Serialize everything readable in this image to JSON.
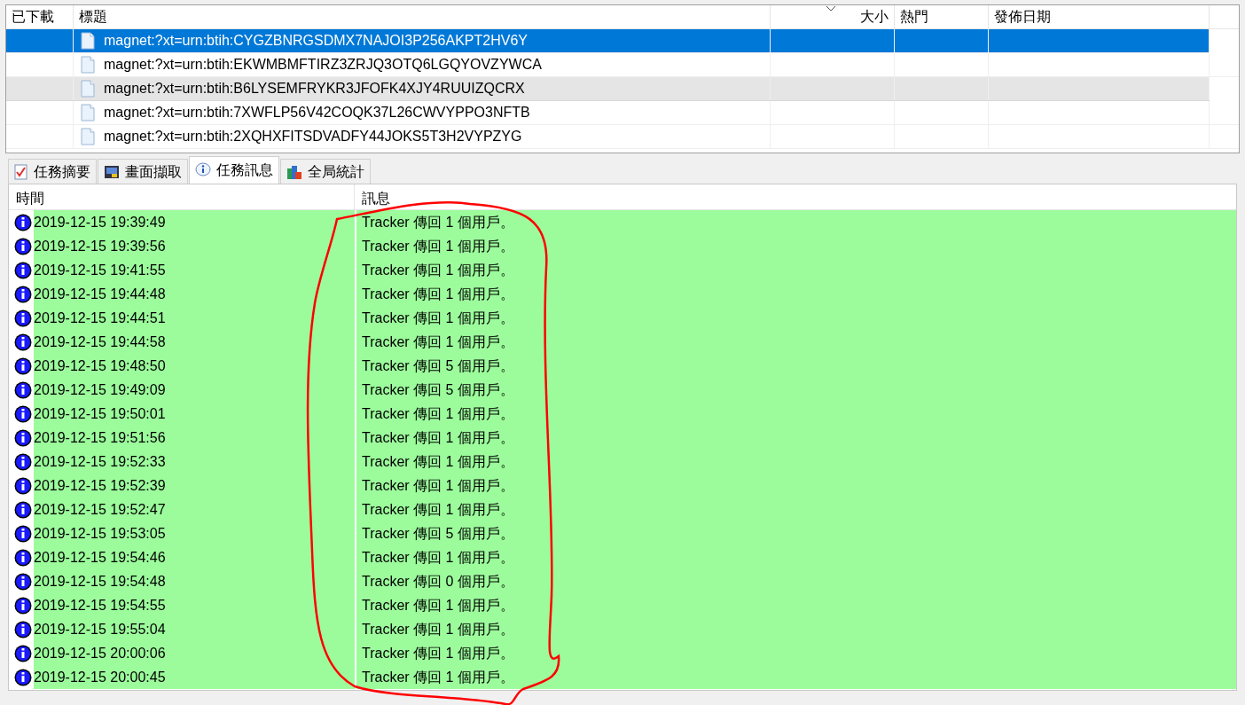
{
  "torrents": {
    "columns": [
      {
        "label": "已下載",
        "sorted": false
      },
      {
        "label": "標題",
        "sorted": false
      },
      {
        "label": "大小",
        "sorted": true
      },
      {
        "label": "熱門",
        "sorted": false
      },
      {
        "label": "發佈日期",
        "sorted": false
      }
    ],
    "rows": [
      {
        "title": "magnet:?xt=urn:btih:CYGZBNRGSDMX7NAJOI3P256AKPT2HV6Y",
        "selected": true,
        "hovered": false
      },
      {
        "title": "magnet:?xt=urn:btih:EKWMBMFTIRZ3ZRJQ3OTQ6LGQYOVZYWCA",
        "selected": false,
        "hovered": false
      },
      {
        "title": "magnet:?xt=urn:btih:B6LYSEMFRYKR3JFOFK4XJY4RUUIZQCRX",
        "selected": false,
        "hovered": true
      },
      {
        "title": "magnet:?xt=urn:btih:7XWFLP56V42COQK37L26CWVYPPO3NFTB",
        "selected": false,
        "hovered": false
      },
      {
        "title": "magnet:?xt=urn:btih:2XQHXFITSDVADFY44JOKS5T3H2VYPZYG",
        "selected": false,
        "hovered": false
      }
    ]
  },
  "tabs": [
    {
      "label": "任務摘要",
      "selected": false
    },
    {
      "label": "畫面擷取",
      "selected": false
    },
    {
      "label": "任務訊息",
      "selected": true
    },
    {
      "label": "全局統計",
      "selected": false
    }
  ],
  "log": {
    "columns": [
      "時間",
      "訊息"
    ],
    "rows": [
      {
        "kind": "info",
        "time": "2019-12-15 19:39:49",
        "message": "Tracker 傳回 1 個用戶。"
      },
      {
        "kind": "info",
        "time": "2019-12-15 19:39:56",
        "message": "Tracker 傳回 1 個用戶。"
      },
      {
        "kind": "info",
        "time": "2019-12-15 19:41:55",
        "message": "Tracker 傳回 1 個用戶。"
      },
      {
        "kind": "info",
        "time": "2019-12-15 19:44:48",
        "message": "Tracker 傳回 1 個用戶。"
      },
      {
        "kind": "info",
        "time": "2019-12-15 19:44:51",
        "message": "Tracker 傳回 1 個用戶。"
      },
      {
        "kind": "info",
        "time": "2019-12-15 19:44:58",
        "message": "Tracker 傳回 1 個用戶。"
      },
      {
        "kind": "info",
        "time": "2019-12-15 19:48:50",
        "message": "Tracker 傳回 5 個用戶。"
      },
      {
        "kind": "info",
        "time": "2019-12-15 19:49:09",
        "message": "Tracker 傳回 5 個用戶。"
      },
      {
        "kind": "info",
        "time": "2019-12-15 19:50:01",
        "message": "Tracker 傳回 1 個用戶。"
      },
      {
        "kind": "info",
        "time": "2019-12-15 19:51:56",
        "message": "Tracker 傳回 1 個用戶。"
      },
      {
        "kind": "info",
        "time": "2019-12-15 19:52:33",
        "message": "Tracker 傳回 1 個用戶。"
      },
      {
        "kind": "info",
        "time": "2019-12-15 19:52:39",
        "message": "Tracker 傳回 1 個用戶。"
      },
      {
        "kind": "info",
        "time": "2019-12-15 19:52:47",
        "message": "Tracker 傳回 1 個用戶。"
      },
      {
        "kind": "info",
        "time": "2019-12-15 19:53:05",
        "message": "Tracker 傳回 5 個用戶。"
      },
      {
        "kind": "info",
        "time": "2019-12-15 19:54:46",
        "message": "Tracker 傳回 1 個用戶。"
      },
      {
        "kind": "info",
        "time": "2019-12-15 19:54:48",
        "message": "Tracker 傳回 0 個用戶。"
      },
      {
        "kind": "info",
        "time": "2019-12-15 19:54:55",
        "message": "Tracker 傳回 1 個用戶。"
      },
      {
        "kind": "info",
        "time": "2019-12-15 19:55:04",
        "message": "Tracker 傳回 1 個用戶。"
      },
      {
        "kind": "info",
        "time": "2019-12-15 20:00:06",
        "message": "Tracker 傳回 1 個用戶。"
      },
      {
        "kind": "info",
        "time": "2019-12-15 20:00:45",
        "message": "Tracker 傳回 1 個用戶。"
      }
    ]
  }
}
